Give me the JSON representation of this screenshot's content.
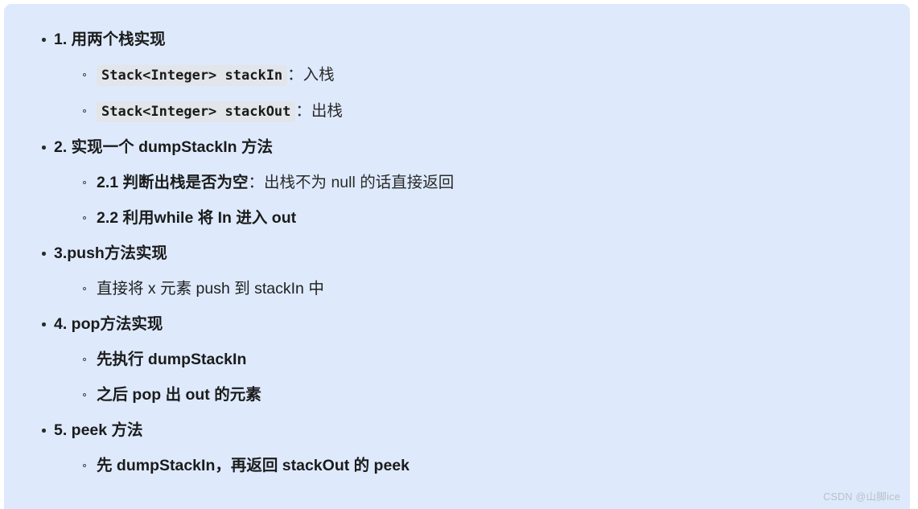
{
  "panel": {
    "background_color": "#deeafc",
    "page_background_color": "#ffffff"
  },
  "watermark": {
    "text": "CSDN @山脚ice",
    "color": "#b9bfc8"
  },
  "outline": [
    {
      "label": "1. 用两个栈实现",
      "children": [
        {
          "code": "Stack<Integer> stackIn",
          "text": "：入栈",
          "bold": false
        },
        {
          "code": "Stack<Integer> stackOut",
          "text": "：出栈",
          "bold": false
        }
      ]
    },
    {
      "label": "2. 实现一个 dumpStackIn 方法",
      "children": [
        {
          "lead": "2.1 判断出栈是否为空",
          "tail": "：出栈不为 null 的话直接返回",
          "bold": false
        },
        {
          "text": "2.2 利用while 将 In 进入 out",
          "bold": true
        }
      ]
    },
    {
      "label": "3.push方法实现",
      "children": [
        {
          "text": "直接将 x 元素 push 到 stackIn 中",
          "bold": false
        }
      ]
    },
    {
      "label": "4. pop方法实现",
      "children": [
        {
          "text": "先执行 dumpStackIn",
          "bold": true
        },
        {
          "text": "之后 pop 出 out 的元素",
          "bold": true
        }
      ]
    },
    {
      "label": "5. peek 方法",
      "children": [
        {
          "text": "先 dumpStackIn，再返回 stackOut 的 peek",
          "bold": true
        }
      ]
    }
  ]
}
